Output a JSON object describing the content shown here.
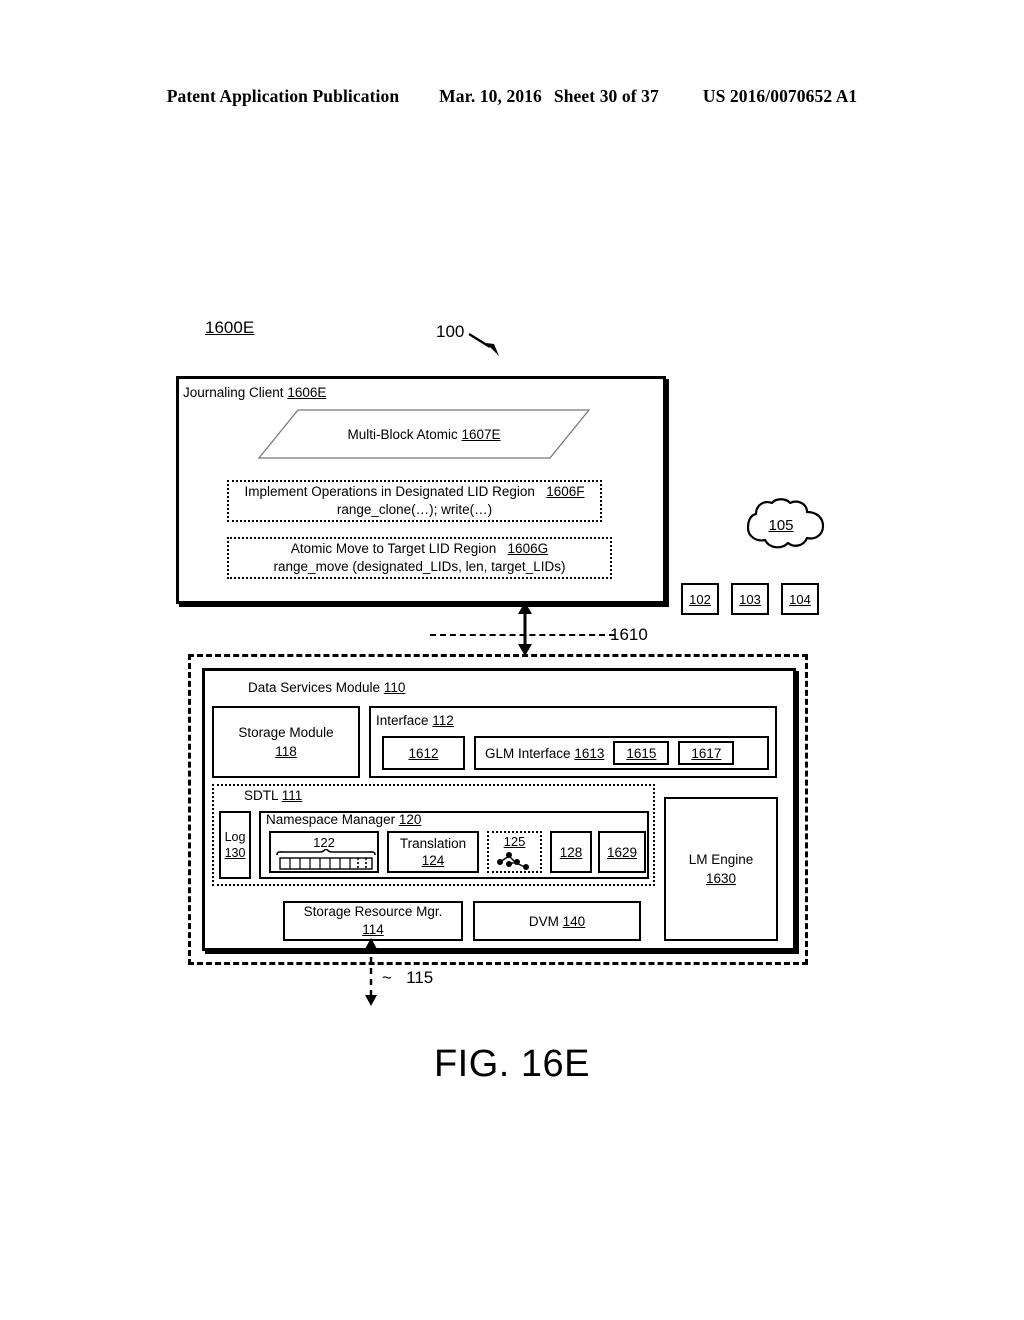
{
  "header": {
    "publication": "Patent Application Publication",
    "date": "Mar. 10, 2016",
    "sheet": "Sheet 30 of 37",
    "patent_number": "US 2016/0070652 A1"
  },
  "figure": {
    "id_label": "1600E",
    "system_ref": "100",
    "caption": "FIG. 16E"
  },
  "journaling_client": {
    "label": "Journaling Client",
    "ref": "1606E",
    "multi_block_atomic": {
      "label": "Multi-Block Atomic",
      "ref": "1607E"
    },
    "designated_region_op": {
      "line1": "Implement Operations in Designated LID Region",
      "ref": "1606F",
      "line2": "range_clone(…); write(…)"
    },
    "atomic_move_op": {
      "line1": "Atomic Move to Target LID Region",
      "ref": "1606G",
      "line2": "range_move (designated_LIDs, len, target_LIDs)"
    }
  },
  "network": {
    "cloud_ref": "105",
    "nodes": [
      "102",
      "103",
      "104"
    ]
  },
  "connections": {
    "client_to_module_ref": "1610",
    "module_to_storage_ref": "115",
    "module_to_storage_prefix": "~"
  },
  "data_services_module": {
    "label": "Data Services Module",
    "ref": "110",
    "storage_module": {
      "label": "Storage Module",
      "ref": "118"
    },
    "interface": {
      "label": "Interface",
      "ref": "112",
      "box_1612": "1612",
      "glm": {
        "label": "GLM Interface",
        "ref": "1613",
        "sub_refs": [
          "1615",
          "1617"
        ]
      }
    },
    "sdtl": {
      "label": "SDTL",
      "ref": "111",
      "log": {
        "label": "Log",
        "ref": "130"
      },
      "namespace_manager": {
        "label": "Namespace Manager",
        "ref": "120",
        "map_ref": "122",
        "translation": {
          "label": "Translation",
          "ref": "124"
        },
        "tree_ref": "125",
        "box_128": "128",
        "box_1629": "1629"
      }
    },
    "lm_engine": {
      "label": "LM Engine",
      "ref": "1630"
    },
    "storage_resource_mgr": {
      "label": "Storage Resource Mgr.",
      "ref": "114"
    },
    "dvm": {
      "label": "DVM",
      "ref": "140"
    }
  }
}
